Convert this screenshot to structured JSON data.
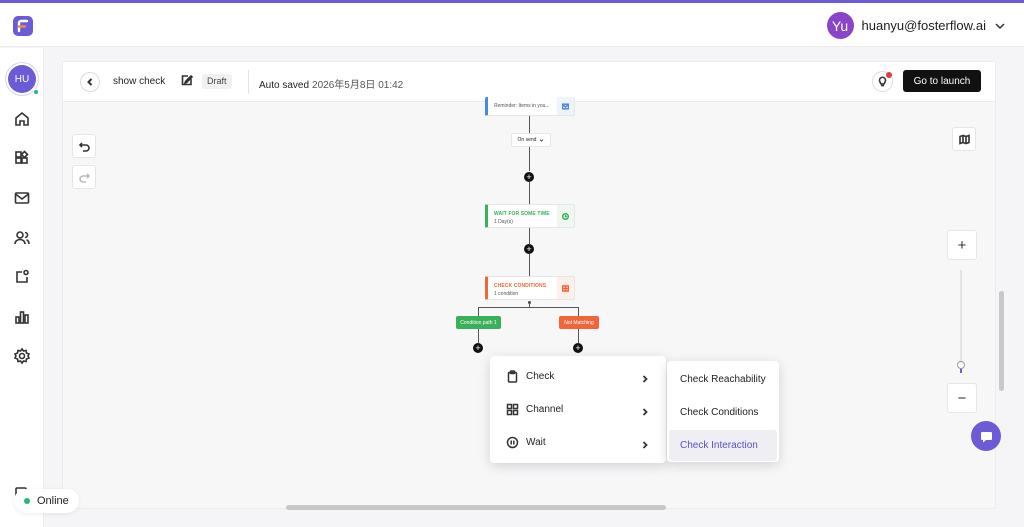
{
  "topbar": {
    "user_initials": "Yu",
    "user_email": "huanyu@fosterflow.ai",
    "logo_icon": "fosterflow-logo-icon"
  },
  "sidebar": {
    "avatar_initials": "HU",
    "items": [
      {
        "icon": "home-icon"
      },
      {
        "icon": "apps-icon"
      },
      {
        "icon": "mail-icon"
      },
      {
        "icon": "users-icon"
      },
      {
        "icon": "journey-icon"
      },
      {
        "icon": "analytics-icon"
      },
      {
        "icon": "settings-icon"
      }
    ]
  },
  "header": {
    "title": "show check",
    "status": "Draft",
    "autosave_label": "Auto saved",
    "autosave_time": "2026年5月8日 01:42",
    "launch_label": "Go to launch"
  },
  "flow": {
    "email_node": {
      "subtitle": "Reminder: Items in you..."
    },
    "on_send": "On send",
    "wait_node": {
      "title": "WAIT FOR SOME TIME",
      "subtitle": "1 Day(s)"
    },
    "check_node": {
      "title": "CHECK CONDITIONS",
      "subtitle": "1 condition"
    },
    "path_matching": "Condition path 1",
    "path_not_matching": "Not Matching"
  },
  "zoom": {
    "plus": "+",
    "minus": "−",
    "level": 0.08
  },
  "menu": {
    "items": [
      {
        "label": "Check",
        "icon": "clipboard-icon"
      },
      {
        "label": "Channel",
        "icon": "grid-icon"
      },
      {
        "label": "Wait",
        "icon": "pause-icon"
      }
    ],
    "submenu": [
      {
        "label": "Check Reachability"
      },
      {
        "label": "Check Conditions"
      },
      {
        "label": "Check Interaction"
      }
    ]
  },
  "status": {
    "online_label": "Online"
  },
  "colors": {
    "accent": "#6b5bd6",
    "email_node": "#4b88e6",
    "wait_node": "#3bb05a",
    "check_node": "#f0653a",
    "not_matching": "#f0653a",
    "online": "#2bb673"
  }
}
